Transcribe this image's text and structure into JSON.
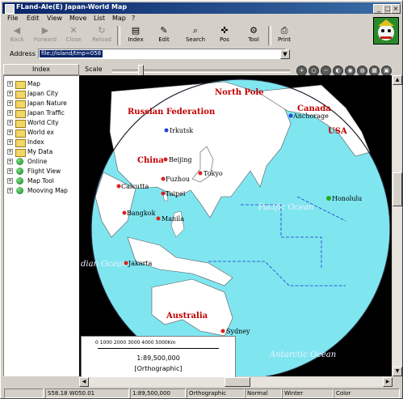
{
  "window": {
    "title": "FLand-Ale(E) Japan-World Map"
  },
  "menu": [
    "File",
    "Edit",
    "View",
    "Move",
    "List",
    "Map",
    "?"
  ],
  "toolbar": {
    "back": "Back",
    "forward": "Forward",
    "close": "Close",
    "reload": "Reload",
    "index": "Index",
    "edit": "Edit",
    "search": "Search",
    "pos": "Pos",
    "tool": "Tool",
    "print": "Print"
  },
  "address": {
    "label": "Address",
    "value": "file://island/tmp=058"
  },
  "sidebar": {
    "header": "Index",
    "items": [
      {
        "label": "Map",
        "icon": "folder-icon"
      },
      {
        "label": "Japan City",
        "icon": "folder-icon"
      },
      {
        "label": "Japan Nature",
        "icon": "folder-icon"
      },
      {
        "label": "Japan Traffic",
        "icon": "folder-icon"
      },
      {
        "label": "World City",
        "icon": "folder-icon"
      },
      {
        "label": "World ex",
        "icon": "folder-icon"
      },
      {
        "label": "Index",
        "icon": "folder-icon"
      },
      {
        "label": "My Data",
        "icon": "folder-icon"
      },
      {
        "label": "Online",
        "icon": "globe-icon"
      },
      {
        "label": "Flight View",
        "icon": "globe-icon"
      },
      {
        "label": "Map Tool",
        "icon": "globe-icon"
      },
      {
        "label": "Mooving Map",
        "icon": "globe-icon"
      }
    ]
  },
  "scale": {
    "label": "Scale"
  },
  "map": {
    "countries": {
      "russia": "Russian Federation",
      "north_pole": "North Pole",
      "canada": "Canada",
      "usa": "USA",
      "china": "China",
      "australia": "Australia"
    },
    "oceans": {
      "pacific": "Pacific Ocean",
      "indian": "dian Ocean",
      "antarctic": "Antarctic Ocean"
    },
    "cities": {
      "irkutsk": "Irkutsk",
      "beijing": "Beijing",
      "tokyo": "Tokyo",
      "fuzhou": "Fuzhou",
      "calcutta": "Calcutta",
      "taipei": "Taipei",
      "bangkok": "Bangkok",
      "manila": "Manila",
      "jakarta": "Jakarta",
      "honolulu": "Honolulu",
      "anchorage": "Anchorage",
      "sydney": "Sydney"
    }
  },
  "legend": {
    "ticks": "0 1000 2000 3000 4000 5000Km",
    "ratio": "1:89,500,000",
    "projection": "[Orthographic]"
  },
  "status": {
    "coords": "S58.18 W050.01",
    "scale": "1:89,500,000",
    "projection": "Orthographic",
    "mode": "Normal",
    "season": "Winter",
    "color": "Color"
  },
  "colors": {
    "ocean": "#7fe6f0",
    "land": "#ffffff",
    "title_bar": "#0a246a",
    "country_label": "#c00000"
  }
}
